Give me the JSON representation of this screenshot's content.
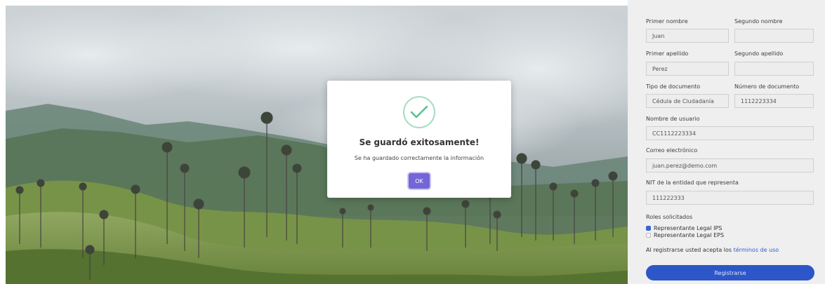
{
  "modal": {
    "title": "Se guardó exitosamente!",
    "message": "Se ha guardado correctamente la información",
    "ok_label": "OK",
    "success_icon": "check-icon",
    "accent_color": "#7465d8"
  },
  "form": {
    "first_name": {
      "label": "Primer nombre",
      "value": "Juan"
    },
    "second_name": {
      "label": "Segundo nombre",
      "value": ""
    },
    "first_surname": {
      "label": "Primer apellido",
      "value": "Perez"
    },
    "second_surname": {
      "label": "Segundo apellido",
      "value": ""
    },
    "doc_type": {
      "label": "Tipo de documento",
      "value": "Cédula de Ciudadanía"
    },
    "doc_number": {
      "label": "Número de documento",
      "value": "1112223334"
    },
    "username": {
      "label": "Nombre de usuario",
      "value": "CC1112223334"
    },
    "email": {
      "label": "Correo electrónico",
      "value": "juan.perez@demo.com"
    },
    "nit": {
      "label": "NIT de la entidad que representa",
      "value": "111222333"
    },
    "roles": {
      "label": "Roles solicitados",
      "options": [
        {
          "label": "Representante Legal IPS",
          "checked": true
        },
        {
          "label": "Representante Legal EPS",
          "checked": false
        }
      ]
    },
    "terms_prefix": "Al registrarse usted acepta los",
    "terms_link": "términos de uso",
    "submit_label": "Registrarse",
    "button_color": "#2d56c8"
  }
}
